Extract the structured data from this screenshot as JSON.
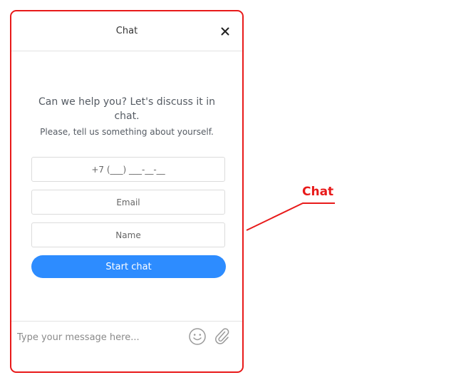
{
  "chat_widget": {
    "title": "Chat",
    "close_icon": "close-icon",
    "intro_heading": "Can we help you? Let's discuss it in chat.",
    "intro_sub": "Please, tell us something about yourself.",
    "phone_placeholder": "+7 (___) ___-__-__",
    "email_placeholder": "Email",
    "name_placeholder": "Name",
    "start_button_label": "Start chat",
    "message_placeholder": "Type your message here...",
    "emoji_icon": "emoji-icon",
    "attach_icon": "paperclip-icon",
    "accent_color": "#2d8cff"
  },
  "annotation": {
    "label": "Chat",
    "color": "#e81a1a"
  }
}
